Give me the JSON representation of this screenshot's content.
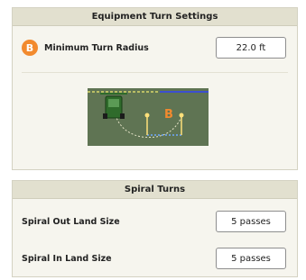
{
  "equipment_turn_settings": {
    "header": "Equipment Turn Settings",
    "badge_letter": "B",
    "min_turn_radius_label": "Minimum Turn Radius",
    "min_turn_radius_value": "22.0 ft",
    "diagram_badge": "B"
  },
  "spiral_turns": {
    "header": "Spiral Turns",
    "out_label": "Spiral Out Land Size",
    "out_value": "5 passes",
    "in_label": "Spiral In Land Size",
    "in_value": "5 passes"
  },
  "colors": {
    "accent_orange": "#f28a2e",
    "header_bg": "#e2e0cf",
    "panel_bg": "#f6f5ee"
  }
}
